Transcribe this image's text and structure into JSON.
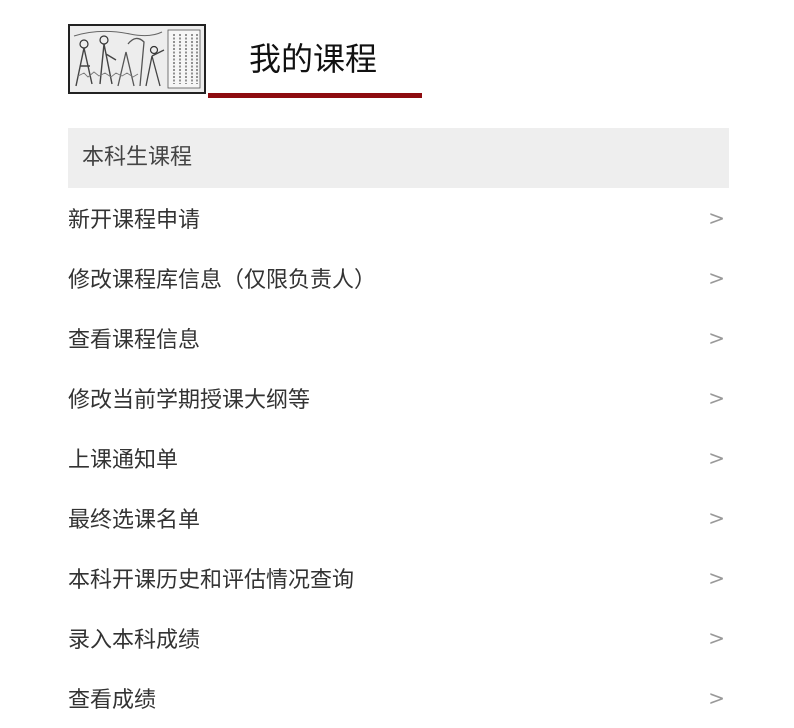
{
  "header": {
    "title": "我的课程",
    "thumbnail_icon": "woodblock-illustration",
    "accent_color": "#8e0c10"
  },
  "section": {
    "label": "本科生课程"
  },
  "menu": {
    "chevron": ">",
    "items": [
      {
        "label": "新开课程申请"
      },
      {
        "label": "修改课程库信息（仅限负责人）"
      },
      {
        "label": "查看课程信息"
      },
      {
        "label": "修改当前学期授课大纲等"
      },
      {
        "label": "上课通知单"
      },
      {
        "label": "最终选课名单"
      },
      {
        "label": "本科开课历史和评估情况查询"
      },
      {
        "label": "录入本科成绩"
      },
      {
        "label": "查看成绩"
      }
    ]
  }
}
